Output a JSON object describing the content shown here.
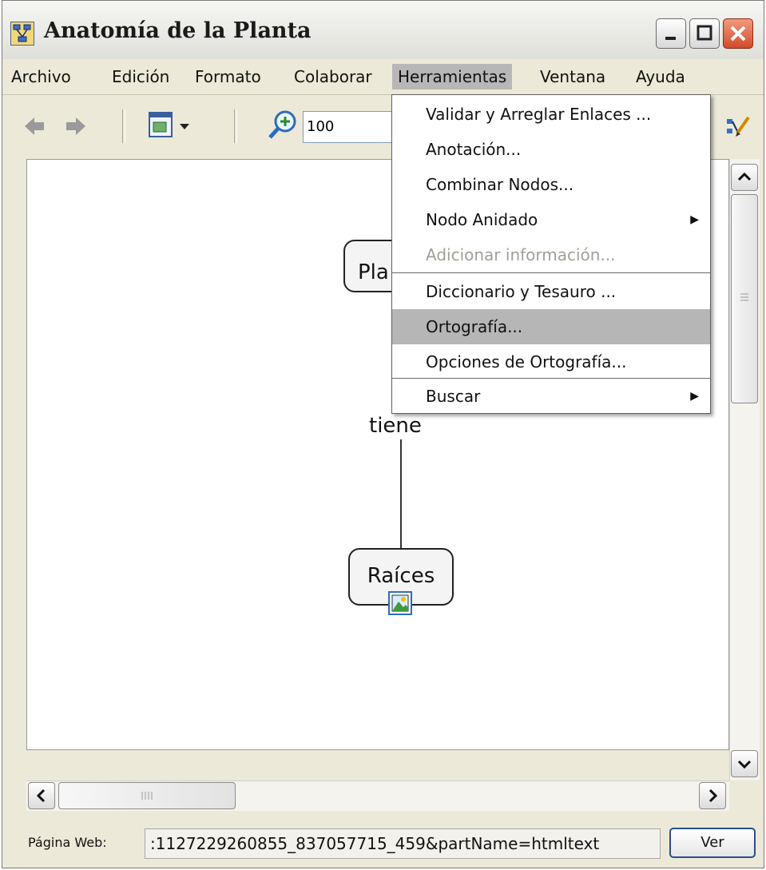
{
  "window": {
    "title": "Anatomía de la Planta"
  },
  "menubar": {
    "items": [
      "Archivo",
      "Edición",
      "Formato",
      "Colaborar",
      "Herramientas",
      "Ventana",
      "Ayuda"
    ],
    "active": "Herramientas"
  },
  "toolbar": {
    "zoom_value": "100"
  },
  "tools_menu": {
    "items": [
      {
        "label": "Validar y Arreglar Enlaces ..."
      },
      {
        "label": "Anotación..."
      },
      {
        "label": "Combinar Nodos..."
      },
      {
        "label": "Nodo Anidado",
        "submenu": true
      },
      {
        "label": "Adicionar información...",
        "disabled": true
      },
      {
        "label": "Diccionario y Tesauro ..."
      },
      {
        "label": "Ortografía...",
        "highlighted": true
      },
      {
        "label": "Opciones de Ortografía..."
      },
      {
        "label": "Buscar",
        "submenu": true
      }
    ]
  },
  "concept_map": {
    "top_node_visible_text": "Pla",
    "link_label": "tiene",
    "bottom_node": "Raíces"
  },
  "statusbar": {
    "web_label": "Página Web:",
    "web_value": ":1127229260855_837057715_459&partName=htmltext",
    "ver_button": "Ver"
  },
  "colors": {
    "menu_highlight": "#b6b6b6",
    "window_bg": "#ece9d8",
    "close_button": "#d14b2a"
  }
}
